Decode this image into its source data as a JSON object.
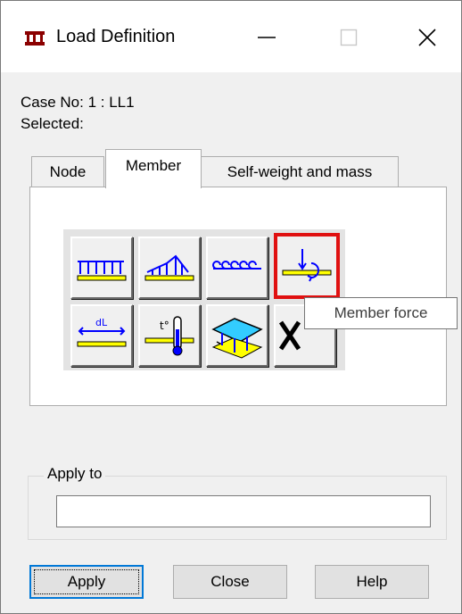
{
  "window": {
    "title": "Load Definition",
    "minimize_icon": "minimize-icon",
    "maximize_icon": "maximize-icon",
    "close_icon": "close-icon"
  },
  "info": {
    "case_no": "Case No: 1 : LL1",
    "selected": "Selected:"
  },
  "tabs": [
    {
      "label": "Node",
      "active": false
    },
    {
      "label": "Member",
      "active": true
    },
    {
      "label": "Self-weight and mass",
      "active": false
    }
  ],
  "tools": [
    {
      "icon": "uniform-load-icon"
    },
    {
      "icon": "trapezoidal-load-icon"
    },
    {
      "icon": "uniform-moment-icon"
    },
    {
      "icon": "member-force-icon",
      "highlighted": true
    },
    {
      "icon": "temperature-length-load-icon"
    },
    {
      "icon": "temperature-load-icon"
    },
    {
      "icon": "floor-load-icon"
    },
    {
      "icon": "delete-load-icon"
    }
  ],
  "tooltip": {
    "text": "Member force"
  },
  "apply_to": {
    "legend": "Apply to",
    "value": ""
  },
  "buttons": {
    "apply": "Apply",
    "close": "Close",
    "help": "Help"
  },
  "colors": {
    "load_blue": "#0000ff",
    "member_yellow": "#ffff00",
    "highlight_red": "#e01010"
  }
}
